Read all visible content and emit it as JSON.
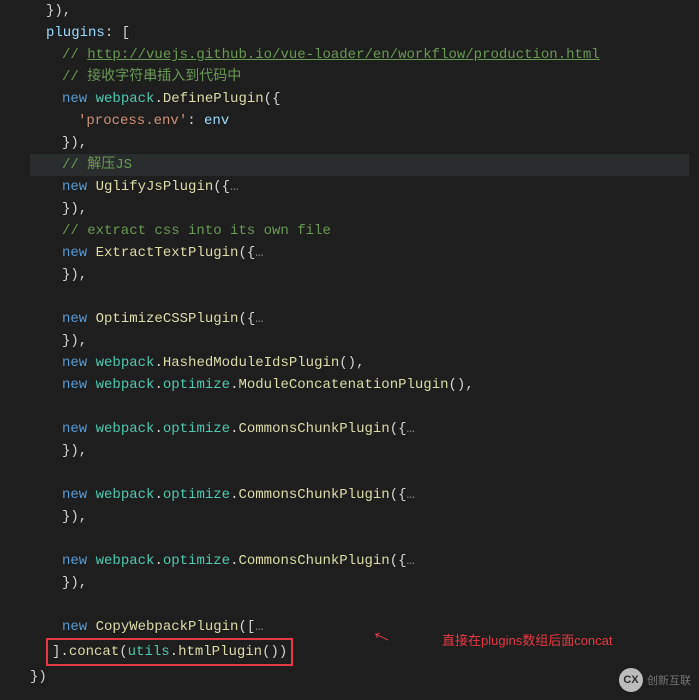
{
  "code": {
    "l1a": "}",
    "l1b": "),",
    "plugins_key": "plugins",
    "bracket_open": ": [",
    "comment_url": "// ",
    "url": "http://vuejs.github.io/vue-loader/en/workflow/production.html",
    "comment_cn1": "// 接收字符串插入到代码中",
    "new": "new",
    "webpack": "webpack",
    "DefinePlugin": "DefinePlugin",
    "open_brace": "({",
    "process_env": "'process.env'",
    "colon": ":",
    "env": " env",
    "close1": "}),",
    "comment_js": "// 解压JS",
    "UglifyJsPlugin": "UglifyJsPlugin",
    "dots": "…",
    "comment_css": "// extract css into its own file",
    "ExtractTextPlugin": "ExtractTextPlugin",
    "OptimizeCSSPlugin": "OptimizeCSSPlugin",
    "HashedModuleIdsPlugin": "HashedModuleIdsPlugin",
    "optimize": "optimize",
    "ModuleConcatenationPlugin": "ModuleConcatenationPlugin",
    "CommonsChunkPlugin": "CommonsChunkPlugin",
    "CopyWebpackPlugin": "CopyWebpackPlugin",
    "open_arr": "([",
    "concat_line_a": "].",
    "concat": "concat",
    "utils": "utils",
    "htmlPlugin": "htmlPlugin",
    "concat_parens": "())",
    "final1": "})",
    "empty_parens": "(),",
    "dot": "."
  },
  "annotation": {
    "text": "直接在plugins数组后面concat"
  },
  "watermark": {
    "logo": "CX",
    "text": "创新互联"
  }
}
